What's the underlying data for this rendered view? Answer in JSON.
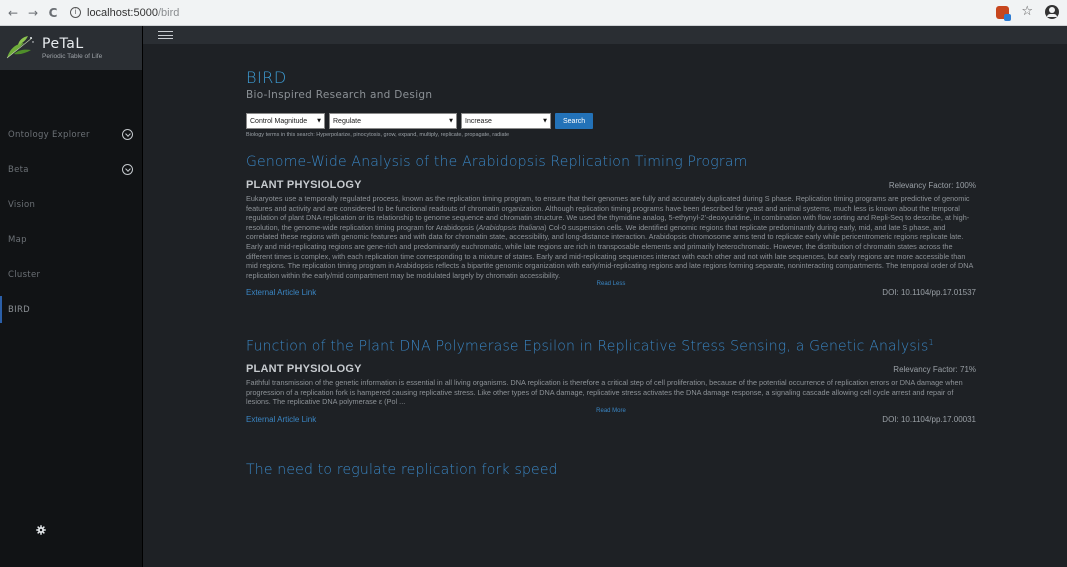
{
  "browser": {
    "back": "←",
    "forward": "→",
    "reload": "C",
    "info": "i",
    "url_host": "localhost:5000",
    "url_path": "/bird",
    "star": "☆"
  },
  "sidebar": {
    "logo_title": "PeTaL",
    "logo_subtitle": "Periodic Table of Life",
    "items": [
      {
        "label": "Ontology Explorer",
        "has_chevron": true
      },
      {
        "label": "Beta",
        "has_chevron": true
      },
      {
        "label": "Vision"
      },
      {
        "label": "Map"
      },
      {
        "label": "Cluster"
      },
      {
        "label": "BIRD",
        "active": true
      }
    ]
  },
  "main": {
    "title": "BIRD",
    "subtitle": "Bio-Inspired Research and Design",
    "search": {
      "select1": "Control Magnitude",
      "select2": "Regulate",
      "select3": "Increase",
      "button": "Search",
      "terms": "Biology terms in this search: Hyperpolarize, pinocytosis, grow, expand, multiply, replicate, propagate, radiate"
    },
    "articles": [
      {
        "title": "Genome-Wide Analysis of the Arabidopsis Replication Timing Program",
        "sup": "",
        "journal": "PLANT PHYSIOLOGY",
        "relevancy": "Relevancy Factor: 100%",
        "abstract_pre": "Eukaryotes use a temporally regulated process, known as the replication timing program, to ensure that their genomes are fully and accurately duplicated during S phase. Replication timing programs are predictive of genomic features and activity and are considered to be functional readouts of chromatin organization. Although replication timing programs have been described for yeast and animal systems, much less is known about the temporal regulation of plant DNA replication or its relationship to genome sequence and chromatin structure. We used the thymidine analog, 5-ethynyl-2′-deoxyuridine, in combination with flow sorting and Repli-Seq to describe, at high-resolution, the genome-wide replication timing program for Arabidopsis (",
        "abstract_italic": "Arabidopsis thaliana",
        "abstract_post": ") Col-0 suspension cells. We identified genomic regions that replicate predominantly during early, mid, and late S phase, and correlated these regions with genomic features and with data for chromatin state, accessibility, and long-distance interaction. Arabidopsis chromosome arms tend to replicate early while pericentromeric regions replicate late. Early and mid-replicating regions are gene-rich and predominantly euchromatic, while late regions are rich in transposable elements and primarily heterochromatic. However, the distribution of chromatin states across the different times is complex, with each replication time corresponding to a mixture of states. Early and mid-replicating sequences interact with each other and not with late sequences, but early regions are more accessible than mid regions. The replication timing program in Arabidopsis reflects a bipartite genomic organization with early/mid-replicating regions and late regions forming separate, noninteracting compartments. The temporal order of DNA replication within the early/mid compartment may be modulated largely by chromatin accessibility.",
        "toggle": "Read Less",
        "link": "External Article Link",
        "doi": "DOI: 10.1104/pp.17.01537"
      },
      {
        "title": "Function of the Plant DNA Polymerase Epsilon in Replicative Stress Sensing, a Genetic Analysis",
        "sup": "1",
        "journal": "PLANT PHYSIOLOGY",
        "relevancy": "Relevancy Factor: 71%",
        "abstract_pre": "Faithful transmission of the genetic information is essential in all living organisms. DNA replication is therefore a critical step of cell proliferation, because of the potential occurrence of replication errors or DNA damage when progression of a replication fork is hampered causing replicative stress. Like other types of DNA damage, replicative stress activates the DNA damage response, a signaling cascade allowing cell cycle arrest and repair of lesions. The replicative DNA polymerase ε (Pol ...",
        "abstract_italic": "",
        "abstract_post": "",
        "toggle": "Read More",
        "link": "External Article Link",
        "doi": "DOI: 10.1104/pp.17.00031"
      },
      {
        "title": "The need to regulate replication fork speed",
        "sup": ""
      }
    ]
  },
  "colors": {
    "accent": "#3a86c4",
    "background": "#1e2125",
    "sidebar": "#111315",
    "active_indicator": "#2b5fa8",
    "search_button": "#2372b8"
  }
}
